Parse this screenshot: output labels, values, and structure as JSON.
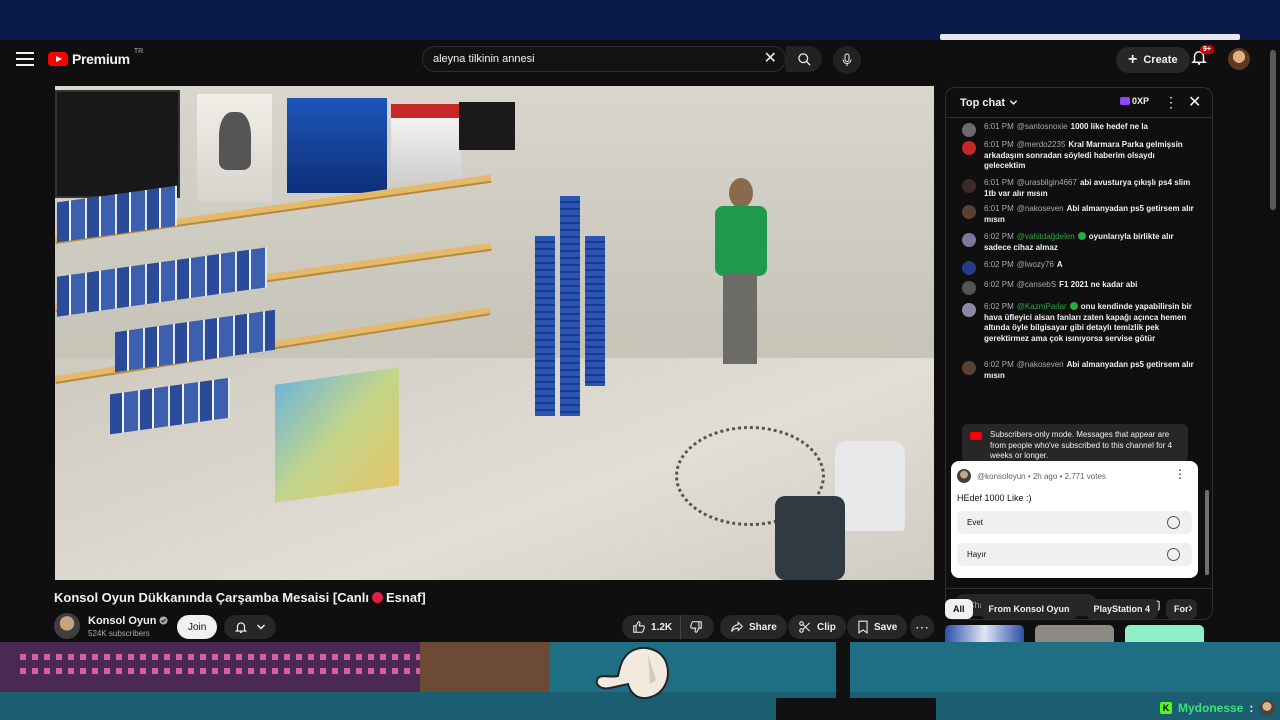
{
  "masthead": {
    "logo_text": "Premium",
    "logo_region": "TR",
    "search_value": "aleyna tilkinin annesi",
    "create_label": "Create",
    "notification_badge": "9+"
  },
  "video": {
    "title_part1": "Konsol Oyun Dükkanında Çarşamba Mesaisi [Canlı",
    "title_part2": "Esnaf]",
    "channel_name": "Konsol Oyun",
    "subscribers": "524K subscribers",
    "join_label": "Join",
    "like_count": "1.2K",
    "share_label": "Share",
    "clip_label": "Clip",
    "save_label": "Save"
  },
  "chat": {
    "mode_label": "Top chat",
    "points_label": "0XP",
    "messages": [
      {
        "time": "6:01 PM",
        "author": "@santosnoxie",
        "text": "1000 like hedef ne la",
        "color": "#6b6b6b",
        "member": false
      },
      {
        "time": "6:01 PM",
        "author": "@merdo2235",
        "text": "Kral Marmara Parka gelmişsin arkadaşım sonradan söyledi haberim olsaydı gelecektim",
        "color": "#c62828",
        "member": false
      },
      {
        "time": "6:01 PM",
        "author": "@urasbilgin4667",
        "text": "abi avusturya çıkışlı ps4 slim 1tb var alır mısın",
        "color": "#3a2a2a",
        "member": false
      },
      {
        "time": "6:01 PM",
        "author": "@nakoseven",
        "text": "Abi almanyadan ps5 getirsem alır mısın",
        "color": "#5a4030",
        "member": false
      },
      {
        "time": "6:02 PM",
        "author": "@vahitdağdelen",
        "text": "oyunlarıyla birlikte alır sadece cihaz almaz",
        "color": "#7a7a9a",
        "member": true
      },
      {
        "time": "6:02 PM",
        "author": "@lwozy76",
        "text": "A",
        "color": "#2a3a8a",
        "member": false
      },
      {
        "time": "6:02 PM",
        "author": "@cansebS",
        "text": "F1 2021 ne kadar abi",
        "color": "#555",
        "member": false
      },
      {
        "time": "6:02 PM",
        "author": "@KazmParlar",
        "text": "onu kendinde yapabilirsin bir hava üfleyici alsan fanları zaten kapağı açınca hemen altında öyle bilgisayar gibi detaylı temizlik pek gerektirmez ama çok ısınıyorsa servise götür",
        "color": "#8a8aa8",
        "member": true
      },
      {
        "time": "6:02 PM",
        "author": "@nakoseven",
        "text": "Abi almanyadan ps5 getirsem alır mısın",
        "color": "#5a4030",
        "member": false
      }
    ],
    "subscribers_mode_text": "Subscribers-only mode. Messages that appear are from people who've subscribed to this channel for 4 weeks or longer.",
    "poll": {
      "meta": "@konsoloyun • 2h ago • 2,771 votes",
      "question": "HEdef 1000 Like :)",
      "options": [
        "Evet",
        "Hayır"
      ]
    },
    "input_placeholder": "Chat as a subscriber..."
  },
  "chips": [
    "All",
    "From Konsol Oyun",
    "PlayStation 4",
    "For"
  ],
  "overlay": {
    "username": "Mydonesse",
    "colon": ":",
    "platform_letter": "K"
  }
}
